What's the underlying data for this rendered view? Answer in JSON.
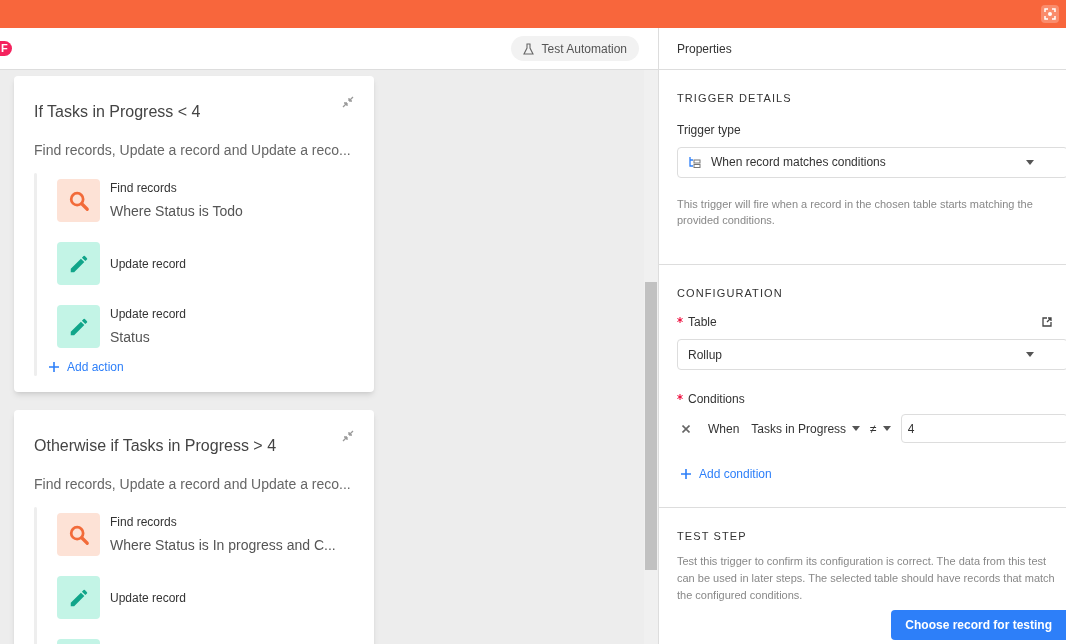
{
  "header": {
    "badge": "F",
    "test_button": "Test Automation"
  },
  "cards": [
    {
      "title": "If Tasks in Progress < 4",
      "summary": "Find records, Update a record and Update a reco...",
      "steps": [
        {
          "kind": "find",
          "title": "Find records",
          "detail": "Where Status is Todo"
        },
        {
          "kind": "update",
          "title": "Update record"
        },
        {
          "kind": "update",
          "title": "Update record",
          "detail": "Status"
        }
      ],
      "add_action": "Add action"
    },
    {
      "title": "Otherwise if Tasks in Progress > 4",
      "summary": "Find records, Update a record and Update a reco...",
      "steps": [
        {
          "kind": "find",
          "title": "Find records",
          "detail": "Where Status is In progress and C..."
        },
        {
          "kind": "update",
          "title": "Update record"
        },
        {
          "kind": "update"
        }
      ]
    }
  ],
  "properties": {
    "title": "Properties",
    "trigger_details": {
      "heading": "TRIGGER DETAILS",
      "label": "Trigger type",
      "value": "When record matches conditions",
      "help": "This trigger will fire when a record in the chosen table starts matching the provided conditions."
    },
    "configuration": {
      "heading": "CONFIGURATION",
      "table_label": "Table",
      "table_value": "Rollup",
      "conditions_label": "Conditions",
      "condition": {
        "when": "When",
        "field": "Tasks in Progress",
        "operator": "≠",
        "value": "4"
      },
      "add_condition": "Add condition"
    },
    "test_step": {
      "heading": "TEST STEP",
      "help": "Test this trigger to confirm its configuration is correct. The data from this test can be used in later steps. The selected table should have records that match the configured conditions.",
      "button": "Choose record for testing"
    }
  }
}
